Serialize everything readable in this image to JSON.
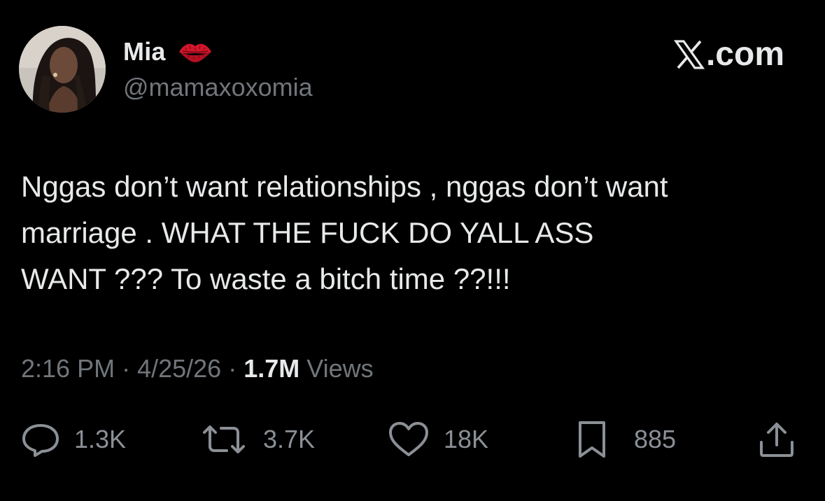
{
  "user": {
    "display_name": "Mia",
    "name_emoji_icon": "kiss-lips-icon",
    "handle": "@mamaxoxomia"
  },
  "brand": {
    "label": ".com",
    "icon": "x-logo-icon"
  },
  "tweet": {
    "text": "Nggas don’t want relationships , nggas don’t want\nmarriage . WHAT THE FUCK DO YALL ASS\nWANT ??? To waste a bitch time ??!!!"
  },
  "meta": {
    "time": "2:16 PM",
    "separator": "·",
    "date": "4/25/26",
    "views_count": "1.7M",
    "views_label": "Views"
  },
  "actions": {
    "replies": "1.3K",
    "reposts": "3.7K",
    "likes": "18K",
    "bookmarks": "885"
  },
  "colors": {
    "background": "#000000",
    "primary_text": "#e7e9ea",
    "secondary_text": "#71767b",
    "accent_emoji": "#d4162a"
  }
}
